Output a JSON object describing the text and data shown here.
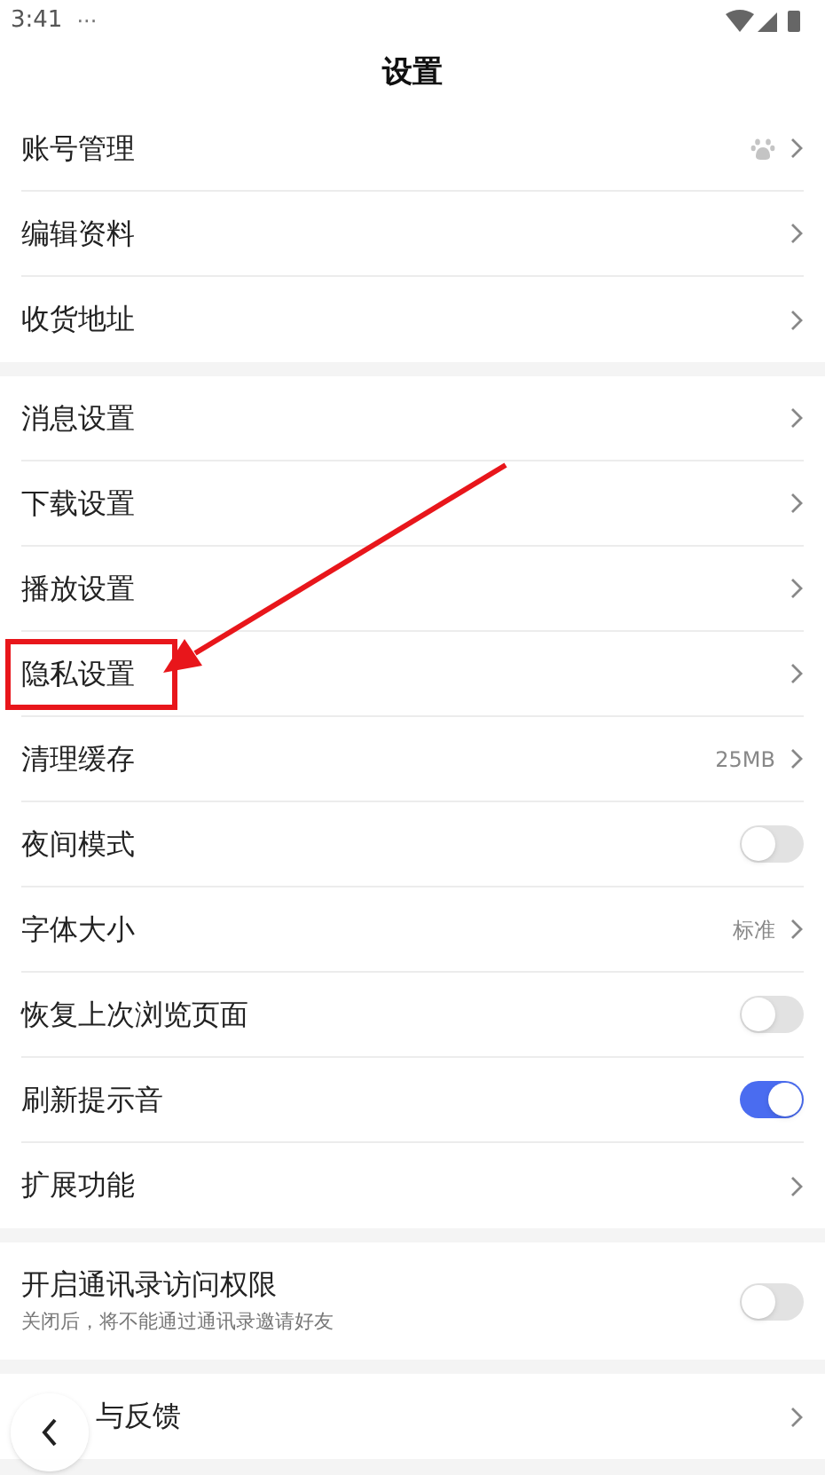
{
  "status_bar": {
    "time": "3:41",
    "dots": "···"
  },
  "title": "设置",
  "groups": [
    {
      "rows": [
        {
          "kind": "link",
          "label": "账号管理"
        },
        {
          "kind": "link",
          "label": "编辑资料"
        },
        {
          "kind": "link",
          "label": "收货地址"
        }
      ]
    },
    {
      "rows": [
        {
          "kind": "link",
          "label": "消息设置"
        },
        {
          "kind": "link",
          "label": "下载设置"
        },
        {
          "kind": "link",
          "label": "播放设置"
        },
        {
          "kind": "link",
          "label": "隐私设置",
          "highlighted": true
        },
        {
          "kind": "link",
          "label": "清理缓存",
          "value": "25MB"
        },
        {
          "kind": "toggle",
          "label": "夜间模式",
          "on": false
        },
        {
          "kind": "link",
          "label": "字体大小",
          "value": "标准"
        },
        {
          "kind": "toggle",
          "label": "恢复上次浏览页面",
          "on": false
        },
        {
          "kind": "toggle",
          "label": "刷新提示音",
          "on": true
        },
        {
          "kind": "link",
          "label": "扩展功能"
        }
      ]
    },
    {
      "rows": [
        {
          "kind": "toggle",
          "label": "开启通讯录访问权限",
          "subtitle": "关闭后，将不能通过通讯录邀请好友",
          "on": false
        }
      ]
    },
    {
      "rows": [
        {
          "kind": "link",
          "label": "与反馈"
        }
      ]
    }
  ]
}
